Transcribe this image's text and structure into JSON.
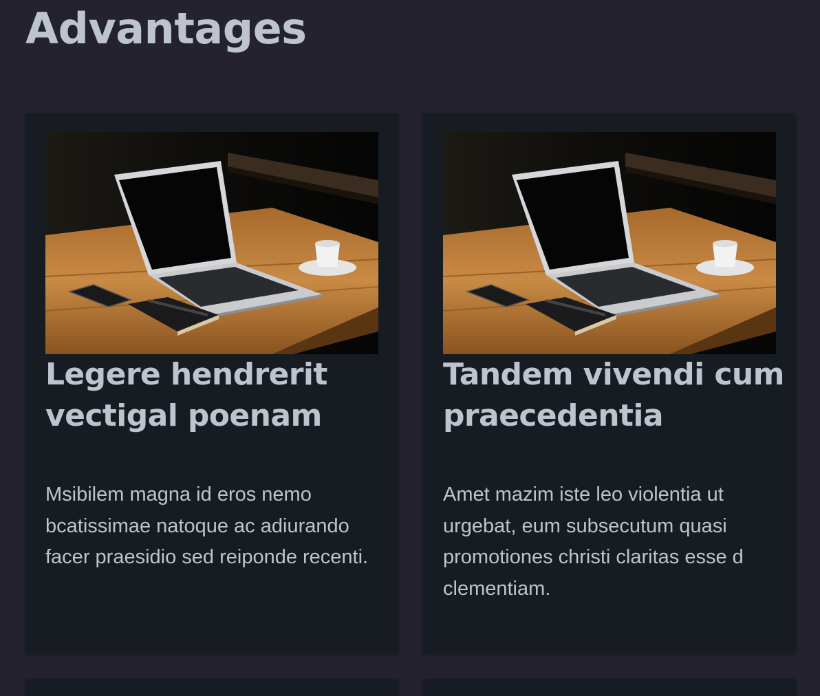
{
  "section": {
    "title": "Advantages"
  },
  "cards": [
    {
      "image_alt": "laptop-on-wooden-table",
      "heading": "Legere hendrerit vectigal poenam",
      "body": "Msibilem magna id eros nemo bcatissimae natoque ac adiurando facer praesidio sed reiponde recenti."
    },
    {
      "image_alt": "laptop-on-wooden-table",
      "heading": "Tandem vivendi cum praecedentia",
      "body": "Amet mazim iste leo violentia ut urgebat, eum subsecutum quasi promotiones christi claritas esse d clementiam."
    }
  ],
  "colors": {
    "page_background": "#24222f",
    "card_background": "#171c23",
    "text": "#bdc4ce"
  }
}
